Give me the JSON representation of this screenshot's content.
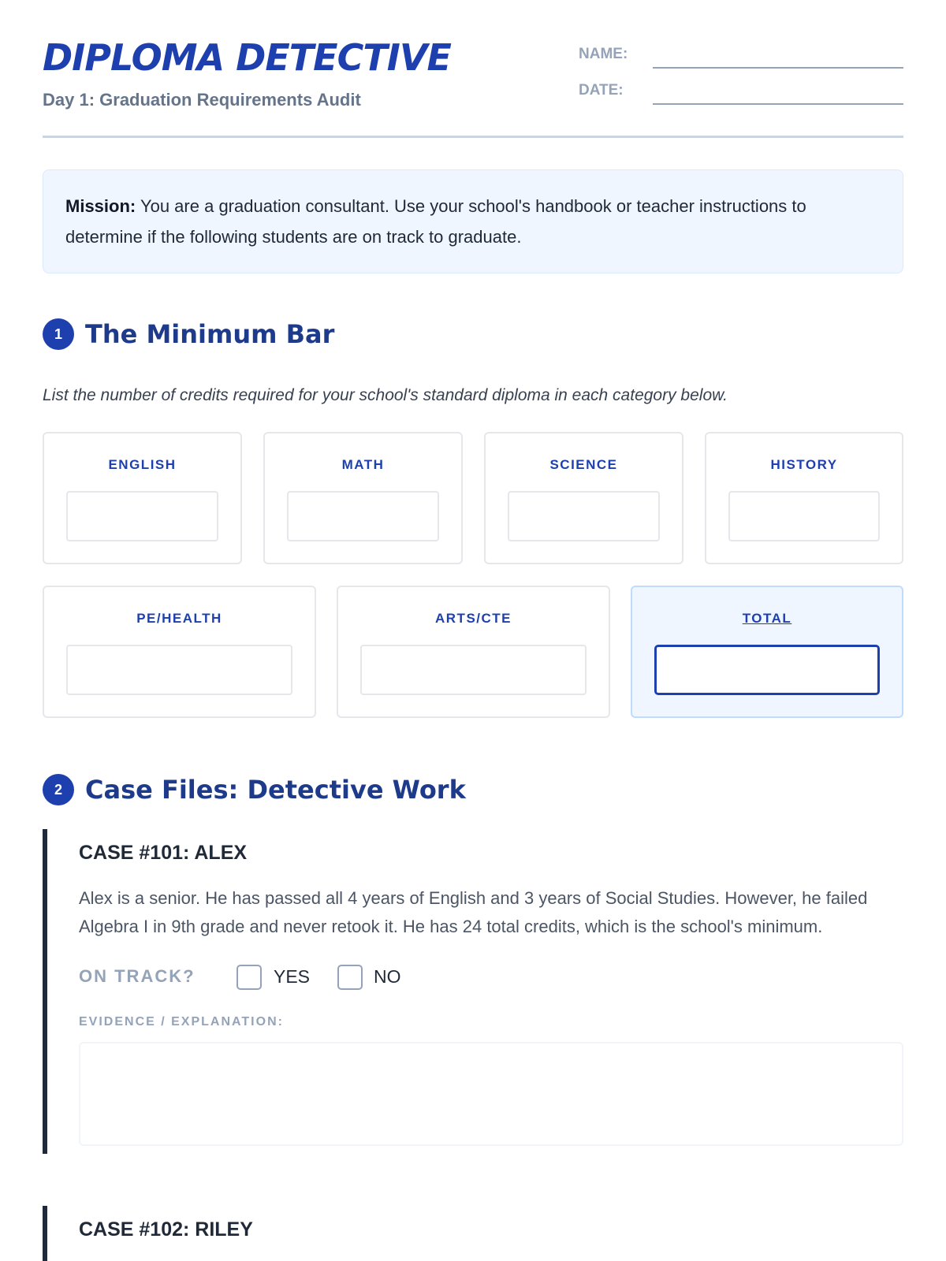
{
  "header": {
    "title": "DIPLOMA DETECTIVE",
    "subtitle": "Day 1: Graduation Requirements Audit",
    "name_label": "NAME:",
    "date_label": "DATE:"
  },
  "mission": {
    "label": "Mission:",
    "text": " You are a graduation consultant. Use your school's handbook or teacher instructions to determine if the following students are on track to graduate."
  },
  "section1": {
    "number": "1",
    "title": "The Minimum Bar",
    "instructions": "List the number of credits required for your school's standard diploma in each category below.",
    "categories": [
      "ENGLISH",
      "MATH",
      "SCIENCE",
      "HISTORY",
      "PE/HEALTH",
      "ARTS/CTE",
      "TOTAL"
    ]
  },
  "section2": {
    "number": "2",
    "title": "Case Files: Detective Work",
    "cases": [
      {
        "title": "CASE #101: ALEX",
        "description": "Alex is a senior. He has passed all 4 years of English and 3 years of Social Studies. However, he failed Algebra I in 9th grade and never retook it. He has 24 total credits, which is the school's minimum.",
        "on_track_label": "ON TRACK?",
        "yes_label": "YES",
        "no_label": "NO",
        "evidence_label": "EVIDENCE / EXPLANATION:"
      },
      {
        "title": "CASE #102: RILEY"
      }
    ]
  },
  "colors": {
    "primary": "#1e40af",
    "heading": "#1e3a8a",
    "mission_bg": "#eff6ff",
    "muted": "#94a3b8",
    "case_bar": "#1e293b"
  }
}
